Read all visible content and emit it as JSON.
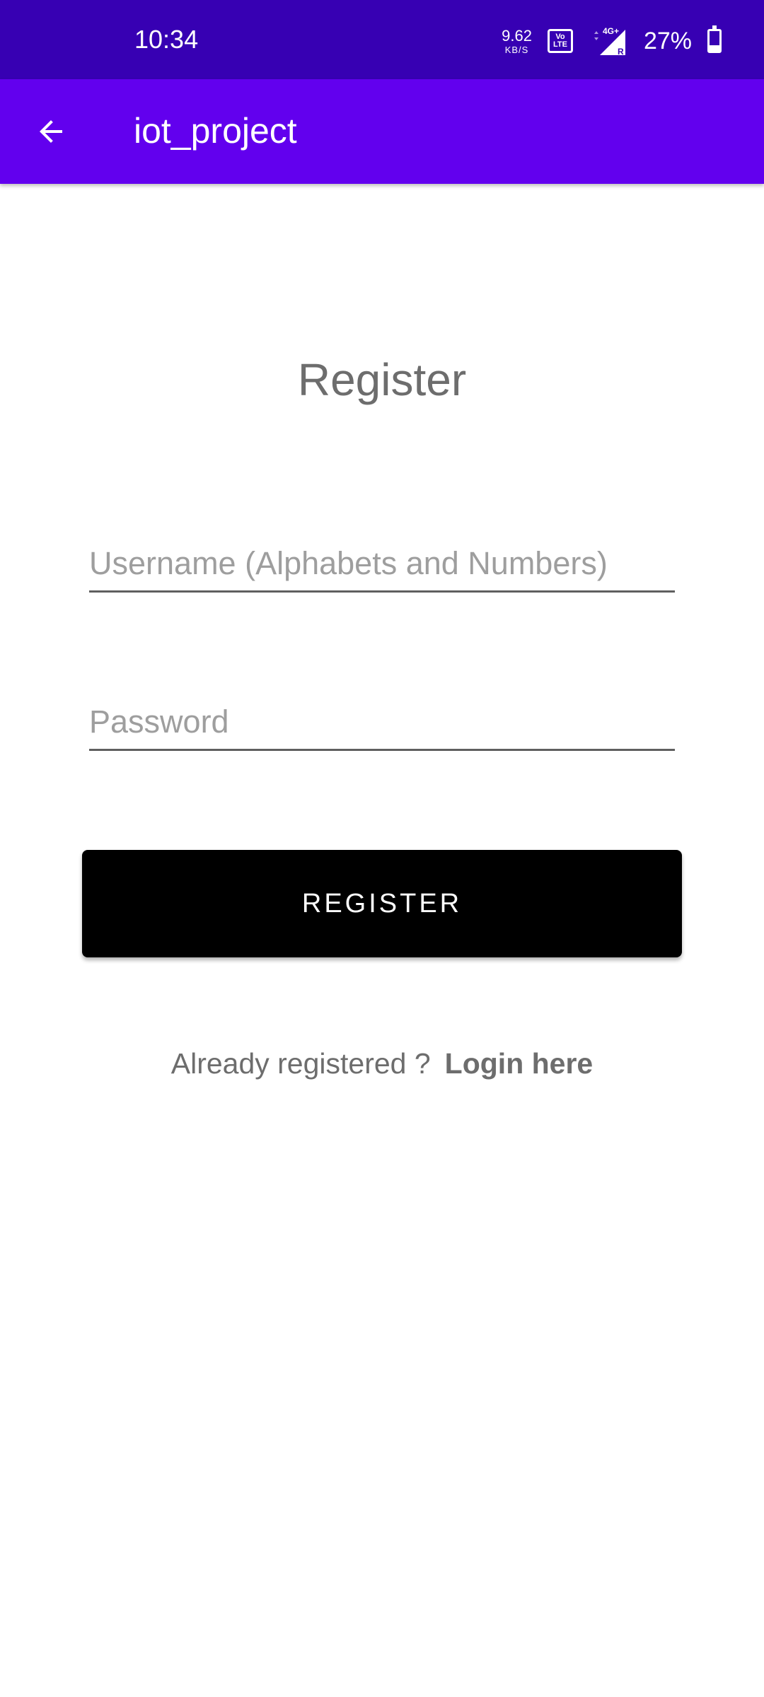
{
  "status_bar": {
    "time": "10:34",
    "net_speed_value": "9.62",
    "net_speed_unit": "KB/S",
    "volte_top": "Vo",
    "volte_bottom": "LTE",
    "network_type": "4G+",
    "roaming": "R",
    "battery_percent": "27%",
    "battery_level": 0.27
  },
  "app_bar": {
    "back_icon": "arrow-left-icon",
    "title": "iot_project"
  },
  "form": {
    "heading": "Register",
    "username_placeholder": "Username (Alphabets and Numbers)",
    "username_value": "",
    "password_placeholder": "Password",
    "password_value": "",
    "register_label": "REGISTER",
    "login_prompt": "Already registered ?",
    "login_link": "Login here"
  },
  "colors": {
    "status_bar": "#3700B3",
    "app_bar": "#6200EE",
    "button": "#000000",
    "text_muted": "#6d6d6d"
  }
}
